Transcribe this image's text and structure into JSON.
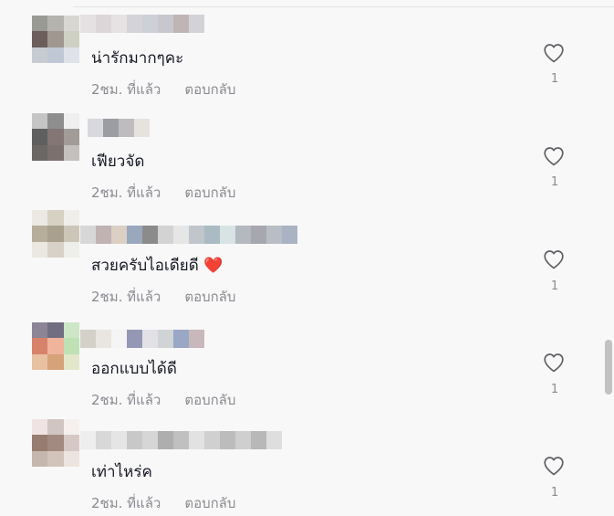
{
  "comments": [
    {
      "text": "น่ารักมากๆคะ",
      "time": "2ชม. ที่แล้ว",
      "reply_label": "ตอบกลับ",
      "like_count": "1",
      "emoji": "",
      "avatar_colors": [
        "#9a9a95",
        "#b5b3ad",
        "#d9d7d2",
        "#6b5e5b",
        "#a09890",
        "#cfd0c4",
        "#c7ccd3",
        "#c0c8d6",
        "#dfe2e8"
      ],
      "username_colors": [
        "#e5e0e2",
        "#ddd6d9",
        "#e6e2e3",
        "#d3d3d8",
        "#cdd0d6",
        "#c9c7ce",
        "#bfb5b7",
        "#d3d2d7"
      ]
    },
    {
      "text": "เฟียวจัด",
      "time": "2ชม. ที่แล้ว",
      "reply_label": "ตอบกลับ",
      "like_count": "1",
      "emoji": "",
      "avatar_colors": [
        "#c5c5c5",
        "#8e8e8e",
        "#efefef",
        "#5f5f5f",
        "#837674",
        "#a19c98",
        "#6a6765",
        "#7c706e",
        "#c3c0bd"
      ],
      "username_colors": [
        "#d8d8de",
        "#9c9ca3",
        "#bfbcc0",
        "#e6e3df"
      ]
    },
    {
      "text": "สวยครับไอเดียดี",
      "time": "2ชม. ที่แล้ว",
      "reply_label": "ตอบกลับ",
      "like_count": "1",
      "emoji": "❤️",
      "avatar_colors": [
        "#ece9e4",
        "#d7d1c4",
        "#f0eeea",
        "#b6ad9b",
        "#aaa08e",
        "#cbc6b8",
        "#ebe7e1",
        "#d7d1c8",
        "#eeeeea"
      ],
      "username_colors": [
        "#d7d7d7",
        "#c1b2b3",
        "#dbd0c3",
        "#9aa8bd",
        "#8c8b8c",
        "#d3d3d3",
        "#e6e6e6",
        "#c0c6cc",
        "#aabbc4",
        "#d8e3e4",
        "#b4b9c0",
        "#a7a7b0",
        "#b9bdc5",
        "#aab3c4"
      ]
    },
    {
      "text": "ออกแบบได้ดี",
      "time": "2ชม. ที่แล้ว",
      "reply_label": "ตอบกลับ",
      "like_count": "1",
      "emoji": "",
      "avatar_colors": [
        "#8b8595",
        "#706e80",
        "#cde6c6",
        "#d8826c",
        "#f0b49d",
        "#bfe1b4",
        "#e8c1a1",
        "#d6a27a",
        "#e3e7c9"
      ],
      "username_colors": [
        "#d4d1c9",
        "#e9e6e1",
        "#f5f5f5",
        "#9498b4",
        "#e1e1e6",
        "#d0d4d6",
        "#9aa8c5",
        "#c8b8bb"
      ]
    },
    {
      "text": "เท่าไหร่ค",
      "time": "2ชม. ที่แล้ว",
      "reply_label": "ตอบกลับ",
      "like_count": "1",
      "emoji": "",
      "avatar_colors": [
        "#efe3e3",
        "#d1c5c1",
        "#f5f0ee",
        "#967d70",
        "#a38a80",
        "#d6c9c4",
        "#c5b7ad",
        "#d2c3bb",
        "#ece5df"
      ],
      "username_colors": [
        "#eeeeee",
        "#d8d8d8",
        "#e5e5e5",
        "#c8c8c8",
        "#d6d6d6",
        "#aeaeae",
        "#c0c0c0",
        "#e2e2e2",
        "#d0d0d0",
        "#bcbcbc",
        "#cfcfcf",
        "#b8b8b8",
        "#dedede"
      ]
    }
  ]
}
